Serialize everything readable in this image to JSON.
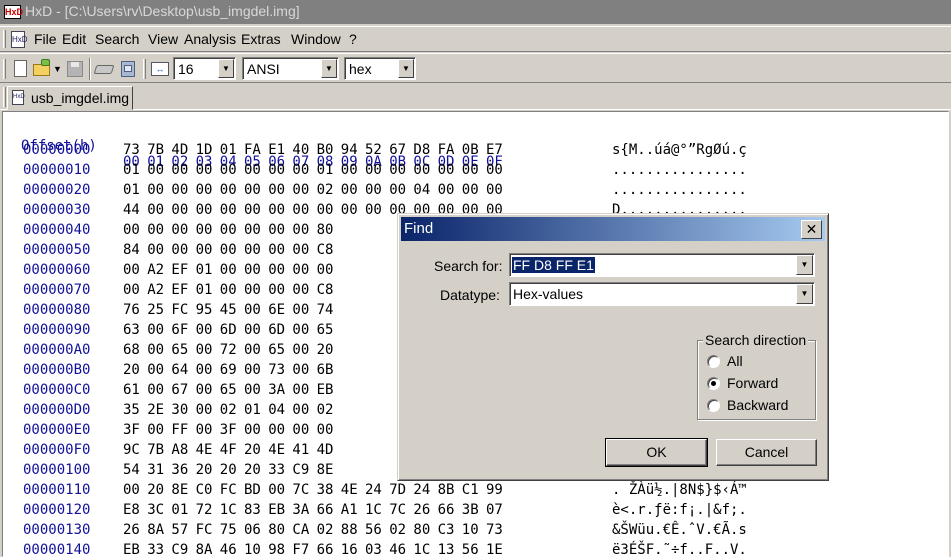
{
  "window": {
    "title": "HxD - [C:\\Users\\rv\\Desktop\\usb_imgdel.img]",
    "icon_text": "HxD"
  },
  "menu": {
    "items": [
      "File",
      "Edit",
      "Search",
      "View",
      "Analysis",
      "Extras",
      "Window",
      "?"
    ]
  },
  "toolbar": {
    "bytes_per_row": "16",
    "charset": "ANSI",
    "offset_base": "hex",
    "columns_icon_text": "↔"
  },
  "tabs": [
    {
      "label": "usb_imgdel.img",
      "icon_text": "HxD"
    }
  ],
  "hex": {
    "header_offset": "Offset(h)",
    "header_cols": [
      "00",
      "01",
      "02",
      "03",
      "04",
      "05",
      "06",
      "07",
      "08",
      "09",
      "0A",
      "0B",
      "0C",
      "0D",
      "0E",
      "0F"
    ],
    "rows": [
      {
        "offset": "00000000",
        "bytes": [
          "73",
          "7B",
          "4D",
          "1D",
          "01",
          "FA",
          "E1",
          "40",
          "B0",
          "94",
          "52",
          "67",
          "D8",
          "FA",
          "0B",
          "E7"
        ],
        "ascii": "s{M..úá@°”RgØú.ç"
      },
      {
        "offset": "00000010",
        "bytes": [
          "01",
          "00",
          "00",
          "00",
          "00",
          "00",
          "00",
          "00",
          "01",
          "00",
          "00",
          "00",
          "00",
          "00",
          "00",
          "00"
        ],
        "ascii": "................"
      },
      {
        "offset": "00000020",
        "bytes": [
          "01",
          "00",
          "00",
          "00",
          "00",
          "00",
          "00",
          "00",
          "02",
          "00",
          "00",
          "00",
          "04",
          "00",
          "00",
          "00"
        ],
        "ascii": "................"
      },
      {
        "offset": "00000030",
        "bytes": [
          "44",
          "00",
          "00",
          "00",
          "00",
          "00",
          "00",
          "00",
          "00",
          "00",
          "00",
          "00",
          "00",
          "00",
          "00",
          "00"
        ],
        "ascii": "D..............."
      },
      {
        "offset": "00000040",
        "bytes": [
          "00",
          "00",
          "00",
          "00",
          "00",
          "00",
          "00",
          "00",
          "80"
        ],
        "ascii": ""
      },
      {
        "offset": "00000050",
        "bytes": [
          "84",
          "00",
          "00",
          "00",
          "00",
          "00",
          "00",
          "00",
          "C8"
        ],
        "ascii": ""
      },
      {
        "offset": "00000060",
        "bytes": [
          "00",
          "A2",
          "EF",
          "01",
          "00",
          "00",
          "00",
          "00",
          "00"
        ],
        "ascii": ""
      },
      {
        "offset": "00000070",
        "bytes": [
          "00",
          "A2",
          "EF",
          "01",
          "00",
          "00",
          "00",
          "00",
          "C8"
        ],
        "ascii": ""
      },
      {
        "offset": "00000080",
        "bytes": [
          "76",
          "25",
          "FC",
          "95",
          "45",
          "00",
          "6E",
          "00",
          "74"
        ],
        "ascii": ""
      },
      {
        "offset": "00000090",
        "bytes": [
          "63",
          "00",
          "6F",
          "00",
          "6D",
          "00",
          "6D",
          "00",
          "65"
        ],
        "ascii": ""
      },
      {
        "offset": "000000A0",
        "bytes": [
          "68",
          "00",
          "65",
          "00",
          "72",
          "00",
          "65",
          "00",
          "20"
        ],
        "ascii": ""
      },
      {
        "offset": "000000B0",
        "bytes": [
          "20",
          "00",
          "64",
          "00",
          "69",
          "00",
          "73",
          "00",
          "6B"
        ],
        "ascii": ""
      },
      {
        "offset": "000000C0",
        "bytes": [
          "61",
          "00",
          "67",
          "00",
          "65",
          "00",
          "3A",
          "00",
          "EB"
        ],
        "ascii": ""
      },
      {
        "offset": "000000D0",
        "bytes": [
          "35",
          "2E",
          "30",
          "00",
          "02",
          "01",
          "04",
          "00",
          "02"
        ],
        "ascii": ""
      },
      {
        "offset": "000000E0",
        "bytes": [
          "3F",
          "00",
          "FF",
          "00",
          "3F",
          "00",
          "00",
          "00",
          "00"
        ],
        "ascii": ""
      },
      {
        "offset": "000000F0",
        "bytes": [
          "9C",
          "7B",
          "A8",
          "4E",
          "4F",
          "20",
          "4E",
          "41",
          "4D"
        ],
        "ascii": ""
      },
      {
        "offset": "00000100",
        "bytes": [
          "54",
          "31",
          "36",
          "20",
          "20",
          "20",
          "33",
          "C9",
          "8E"
        ],
        "ascii": ""
      },
      {
        "offset": "00000110",
        "bytes": [
          "00",
          "20",
          "8E",
          "C0",
          "FC",
          "BD",
          "00",
          "7C",
          "38",
          "4E",
          "24",
          "7D",
          "24",
          "8B",
          "C1",
          "99"
        ],
        "ascii": ". ŽÀü½.|8N$}$‹Á™"
      },
      {
        "offset": "00000120",
        "bytes": [
          "E8",
          "3C",
          "01",
          "72",
          "1C",
          "83",
          "EB",
          "3A",
          "66",
          "A1",
          "1C",
          "7C",
          "26",
          "66",
          "3B",
          "07"
        ],
        "ascii": "è<.r.ƒë:f¡.|&f;."
      },
      {
        "offset": "00000130",
        "bytes": [
          "26",
          "8A",
          "57",
          "FC",
          "75",
          "06",
          "80",
          "CA",
          "02",
          "88",
          "56",
          "02",
          "80",
          "C3",
          "10",
          "73"
        ],
        "ascii": "&ŠWüu.€Ê.ˆV.€Ã.s"
      },
      {
        "offset": "00000140",
        "bytes": [
          "EB",
          "33",
          "C9",
          "8A",
          "46",
          "10",
          "98",
          "F7",
          "66",
          "16",
          "03",
          "46",
          "1C",
          "13",
          "56",
          "1E"
        ],
        "ascii": "ë3ÉŠF.˜÷f..F..V."
      }
    ]
  },
  "find_dialog": {
    "title": "Find",
    "close_glyph": "✕",
    "search_label": "Search for:",
    "search_value": "FF D8 FF E1",
    "datatype_label": "Datatype:",
    "datatype_value": "Hex-values",
    "direction_label": "Search direction",
    "direction_options": [
      "All",
      "Forward",
      "Backward"
    ],
    "direction_selected": "Forward",
    "ok_label": "OK",
    "cancel_label": "Cancel"
  }
}
